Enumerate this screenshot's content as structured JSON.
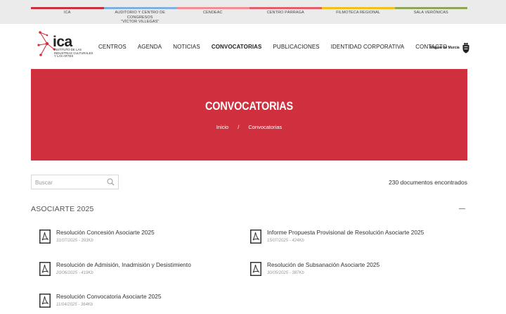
{
  "top_nav": [
    {
      "label": "ICA",
      "color": "#c8323e"
    },
    {
      "label": "AUDITORIO Y CENTRO DE CONGRESOS\n\"VÍCTOR VILLEGAS\"",
      "color": "#7fb0df"
    },
    {
      "label": "CENDEAC",
      "color": "#f08d96"
    },
    {
      "label": "CENTRO PÁRRAGA",
      "color": "#e2606b"
    },
    {
      "label": "FILMOTECA REGIONAL",
      "color": "#f2c01e"
    },
    {
      "label": "SALA VERÓNICAS",
      "color": "#8fa65a"
    }
  ],
  "logo": {
    "word": "ica",
    "subtitle": "INSTITUTO DE LAS\nINDUSTRIAS CULTURALES\nY LAS ARTES",
    "accent_color": "#d0303d"
  },
  "main_nav": [
    {
      "label": "CENTROS",
      "active": false
    },
    {
      "label": "AGENDA",
      "active": false
    },
    {
      "label": "NOTICIAS",
      "active": false
    },
    {
      "label": "CONVOCATORIAS",
      "active": true
    },
    {
      "label": "PUBLICACIONES",
      "active": false
    },
    {
      "label": "IDENTIDAD CORPORATIVA",
      "active": false
    },
    {
      "label": "CONTACTO",
      "active": false
    }
  ],
  "region": {
    "label": "Región de Murcia",
    "icon": "coat-of-arms-icon"
  },
  "hero": {
    "title": "CONVOCATORIAS",
    "breadcrumb_home": "Inicio",
    "breadcrumb_sep": "/",
    "breadcrumb_current": "Convocatorias",
    "color": "#d0303d"
  },
  "search": {
    "placeholder": "Buscar",
    "value": "",
    "icon": "search-icon"
  },
  "results_count": "230 documentos encontrados",
  "section": {
    "title": "ASOCIARTE 2025",
    "icon": "collapse-minus-icon"
  },
  "documents": [
    {
      "title": "Resolución Concesión Asociarte 2025",
      "meta": "31/07/2025 - 393Kb"
    },
    {
      "title": "Informe Propuesta Provisional de Resolución Asociarte 2025",
      "meta": "15/07/2025 - 424Kb"
    },
    {
      "title": "Resolución de Admisión, Inadmisión y Desistimiento",
      "meta": "20/06/2025 - 419Kb"
    },
    {
      "title": "Resolución de Subsanación Asociarte 2025",
      "meta": "30/05/2025 - 387Kb"
    },
    {
      "title": "Resolución Convocatoria Asociarte 2025",
      "meta": "11/04/2025 - 364Kb"
    }
  ]
}
